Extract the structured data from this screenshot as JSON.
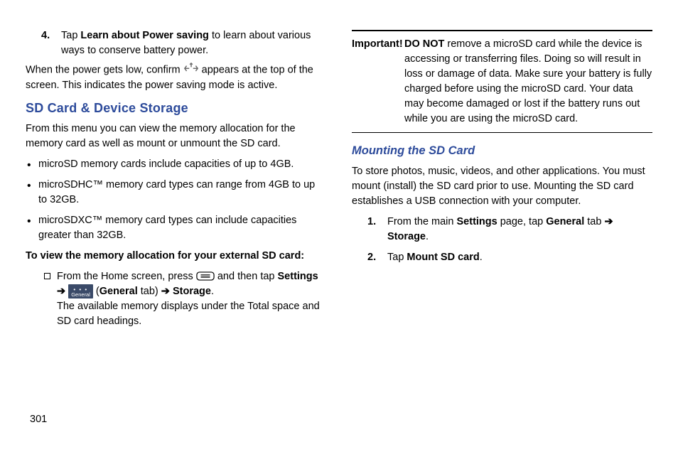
{
  "col1": {
    "step4_num": "4.",
    "step4_text_pre": "Tap ",
    "step4_bold": "Learn about Power saving",
    "step4_text_post": " to learn about various ways to conserve battery power.",
    "power_low_pre": "When the power gets low, confirm ",
    "power_low_post": " appears at the top of the screen. This indicates the power saving mode is active.",
    "heading": "SD Card & Device Storage",
    "intro": "From this menu you can view the memory allocation for the memory card as well as mount or unmount the SD card.",
    "bullet1": "microSD memory cards include capacities of up to 4GB.",
    "bullet2": "microSDHC™ memory card types can range from 4GB to up to 32GB.",
    "bullet3": "microSDXC™ memory card types can include capacities greater than 32GB.",
    "subhead": "To view the memory allocation for your external SD card:",
    "sq_pre": "From the Home screen, press ",
    "sq_mid1": " and then tap ",
    "sq_settings": "Settings",
    "sq_arrow": " ➔ ",
    "sq_general_lbl": "General",
    "sq_general_open": " (",
    "sq_general_bold": "General",
    "sq_general_close": " tab) ",
    "sq_storage": "Storage",
    "sq_period": ".",
    "sq_tail": "The available memory displays under the Total space and SD card headings."
  },
  "col2": {
    "imp_label": "Important!",
    "imp_bold": "DO NOT",
    "imp_body": " remove a microSD card while the device is accessing or transferring files. Doing so will result in loss or damage of data. Make sure your battery is fully charged before using the microSD card. Your data may become damaged or lost if the battery runs out while you are using the microSD card.",
    "heading": "Mounting the SD Card",
    "intro": "To store photos, music, videos, and other applications. You must mount (install) the SD card prior to use. Mounting the SD card establishes a USB connection with your computer.",
    "s1_num": "1.",
    "s1_pre": "From the main ",
    "s1_settings": "Settings",
    "s1_mid": " page, tap ",
    "s1_general": "General",
    "s1_tab": " tab ",
    "s1_arrow": "➔",
    "s1_storage": "Storage",
    "s1_period": ".",
    "s2_num": "2.",
    "s2_pre": "Tap ",
    "s2_bold": "Mount SD card",
    "s2_period": "."
  },
  "page_num": "301"
}
